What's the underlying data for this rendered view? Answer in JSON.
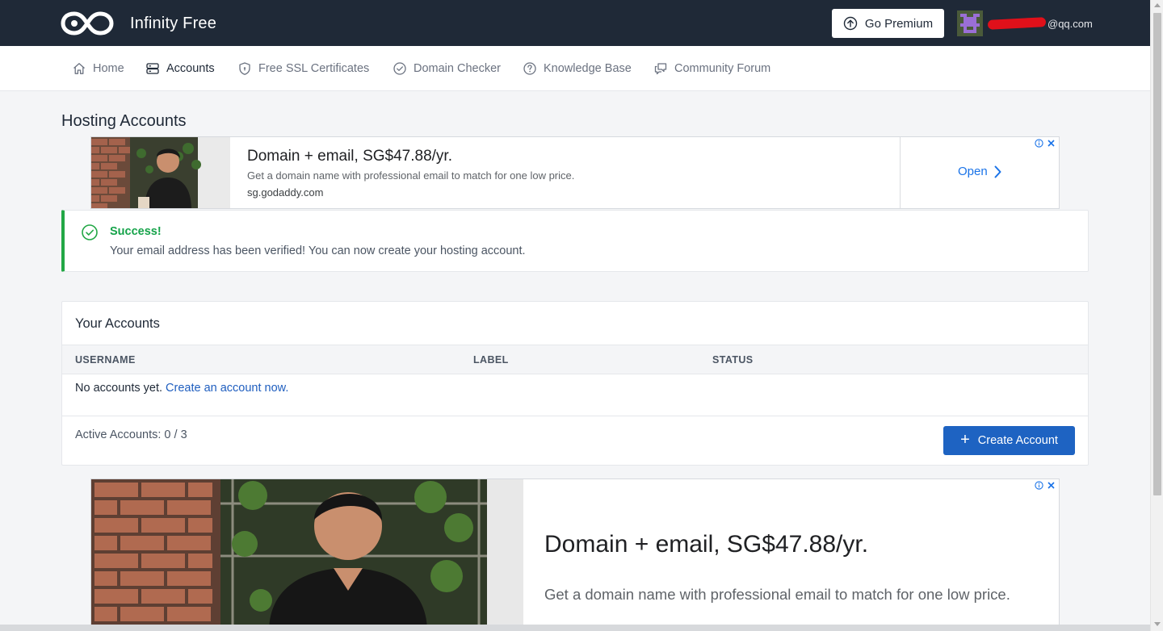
{
  "header": {
    "brand_name": "Infinity Free",
    "premium_label": "Go Premium",
    "user_email": "@qq.com"
  },
  "nav": {
    "items": [
      {
        "label": "Home",
        "icon": "home-icon"
      },
      {
        "label": "Accounts",
        "icon": "server-icon"
      },
      {
        "label": "Free SSL Certificates",
        "icon": "shield-icon"
      },
      {
        "label": "Domain Checker",
        "icon": "check-circle-icon"
      },
      {
        "label": "Knowledge Base",
        "icon": "question-circle-icon"
      },
      {
        "label": "Community Forum",
        "icon": "chat-icon"
      }
    ],
    "active": "Accounts"
  },
  "page": {
    "title": "Hosting Accounts"
  },
  "ad_top": {
    "title": "Domain + email, SG$47.88/yr.",
    "description": "Get a domain name with professional email to match for one low price.",
    "url": "sg.godaddy.com",
    "cta": "Open"
  },
  "alert": {
    "title": "Success!",
    "message": "Your email address has been verified! You can now create your hosting account."
  },
  "accounts": {
    "title": "Your Accounts",
    "columns": [
      "USERNAME",
      "LABEL",
      "STATUS"
    ],
    "empty_text": "No accounts yet.",
    "empty_link": "Create an account now.",
    "active_count": "Active Accounts: 0 / 3",
    "create_label": "Create Account"
  },
  "ad_bottom": {
    "title": "Domain + email, SG$47.88/yr.",
    "description": "Get a domain name with professional email to match for one low price."
  },
  "colors": {
    "topbar": "#1f2937",
    "primary": "#1e63c2",
    "success": "#22a745",
    "link": "#1f5ebf"
  }
}
